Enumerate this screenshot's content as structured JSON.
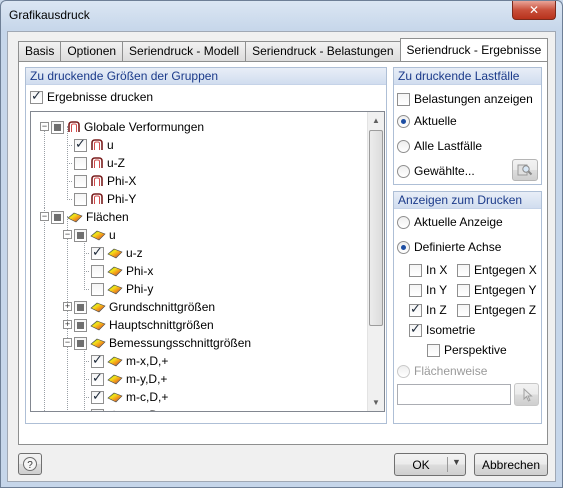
{
  "window": {
    "title": "Grafikausdruck",
    "close_glyph": "✕"
  },
  "tabs": [
    {
      "label": "Basis"
    },
    {
      "label": "Optionen"
    },
    {
      "label": "Seriendruck - Modell"
    },
    {
      "label": "Seriendruck - Belastungen"
    },
    {
      "label": "Seriendruck - Ergebnisse"
    }
  ],
  "active_tab": "Seriendruck - Ergebnisse",
  "groups_panel": {
    "header": "Zu druckende Größen der Gruppen",
    "print_results": {
      "label": "Ergebnisse drucken",
      "checked": true
    },
    "tree": [
      {
        "label": "Globale Verformungen",
        "level": 0,
        "state": "partial",
        "icon": "deformation-icon",
        "expander": "−"
      },
      {
        "label": "u",
        "level": 1,
        "state": "checked",
        "icon": "deformation-icon"
      },
      {
        "label": "u-Z",
        "level": 1,
        "state": "unchecked",
        "icon": "deformation-icon"
      },
      {
        "label": "Phi-X",
        "level": 1,
        "state": "unchecked",
        "icon": "deformation-icon"
      },
      {
        "label": "Phi-Y",
        "level": 1,
        "state": "unchecked",
        "icon": "deformation-icon"
      },
      {
        "label": "Flächen",
        "level": 0,
        "state": "partial",
        "icon": "surface-icon",
        "expander": "−"
      },
      {
        "label": "u",
        "level": 1,
        "state": "partial",
        "icon": "surface-icon",
        "expander": "−"
      },
      {
        "label": "u-z",
        "level": 2,
        "state": "checked",
        "icon": "surface-icon"
      },
      {
        "label": "Phi-x",
        "level": 2,
        "state": "unchecked",
        "icon": "surface-icon"
      },
      {
        "label": "Phi-y",
        "level": 2,
        "state": "unchecked",
        "icon": "surface-icon"
      },
      {
        "label": "Grundschnittgrößen",
        "level": 1,
        "state": "partial",
        "icon": "surface-icon",
        "expander": "+"
      },
      {
        "label": "Hauptschnittgrößen",
        "level": 1,
        "state": "partial",
        "icon": "surface-icon",
        "expander": "+"
      },
      {
        "label": "Bemessungsschnittgrößen",
        "level": 1,
        "state": "partial",
        "icon": "surface-icon",
        "expander": "−"
      },
      {
        "label": "m-x,D,+",
        "level": 2,
        "state": "checked",
        "icon": "surface-icon"
      },
      {
        "label": "m-y,D,+",
        "level": 2,
        "state": "checked",
        "icon": "surface-icon"
      },
      {
        "label": "m-c,D,+",
        "level": 2,
        "state": "checked",
        "icon": "surface-icon"
      },
      {
        "label": "m-x,D,-",
        "level": 2,
        "state": "unchecked",
        "icon": "surface-icon"
      }
    ]
  },
  "loadcases_panel": {
    "header": "Zu druckende Lastfälle",
    "show_loads": {
      "label": "Belastungen anzeigen",
      "checked": false
    },
    "options": [
      {
        "label": "Aktuelle",
        "selected": true
      },
      {
        "label": "Alle Lastfälle",
        "selected": false
      },
      {
        "label": "Gewählte...",
        "selected": false
      }
    ]
  },
  "display_panel": {
    "header": "Anzeigen zum Drucken",
    "options": [
      {
        "label": "Aktuelle Anzeige",
        "selected": false
      },
      {
        "label": "Definierte Achse",
        "selected": true
      }
    ],
    "axes": [
      {
        "label": "In X",
        "checked": false
      },
      {
        "label": "Entgegen X",
        "checked": false
      },
      {
        "label": "In Y",
        "checked": false
      },
      {
        "label": "Entgegen Y",
        "checked": false
      },
      {
        "label": "In Z",
        "checked": true
      },
      {
        "label": "Entgegen Z",
        "checked": false
      }
    ],
    "isometric": {
      "label": "Isometrie",
      "checked": true
    },
    "perspective": {
      "label": "Perspektive",
      "checked": false
    },
    "surfacewise": {
      "label": "Flächenweise",
      "selected": false,
      "disabled": true
    },
    "surface_input": {
      "value": ""
    }
  },
  "footer": {
    "ok_label": "OK",
    "cancel_label": "Abbrechen"
  },
  "colors": {
    "header_text": "#1b3a8a",
    "header_bg": "#d1ddef",
    "radio_dot": "#1d4ea3",
    "close_button": "#c9503b"
  }
}
